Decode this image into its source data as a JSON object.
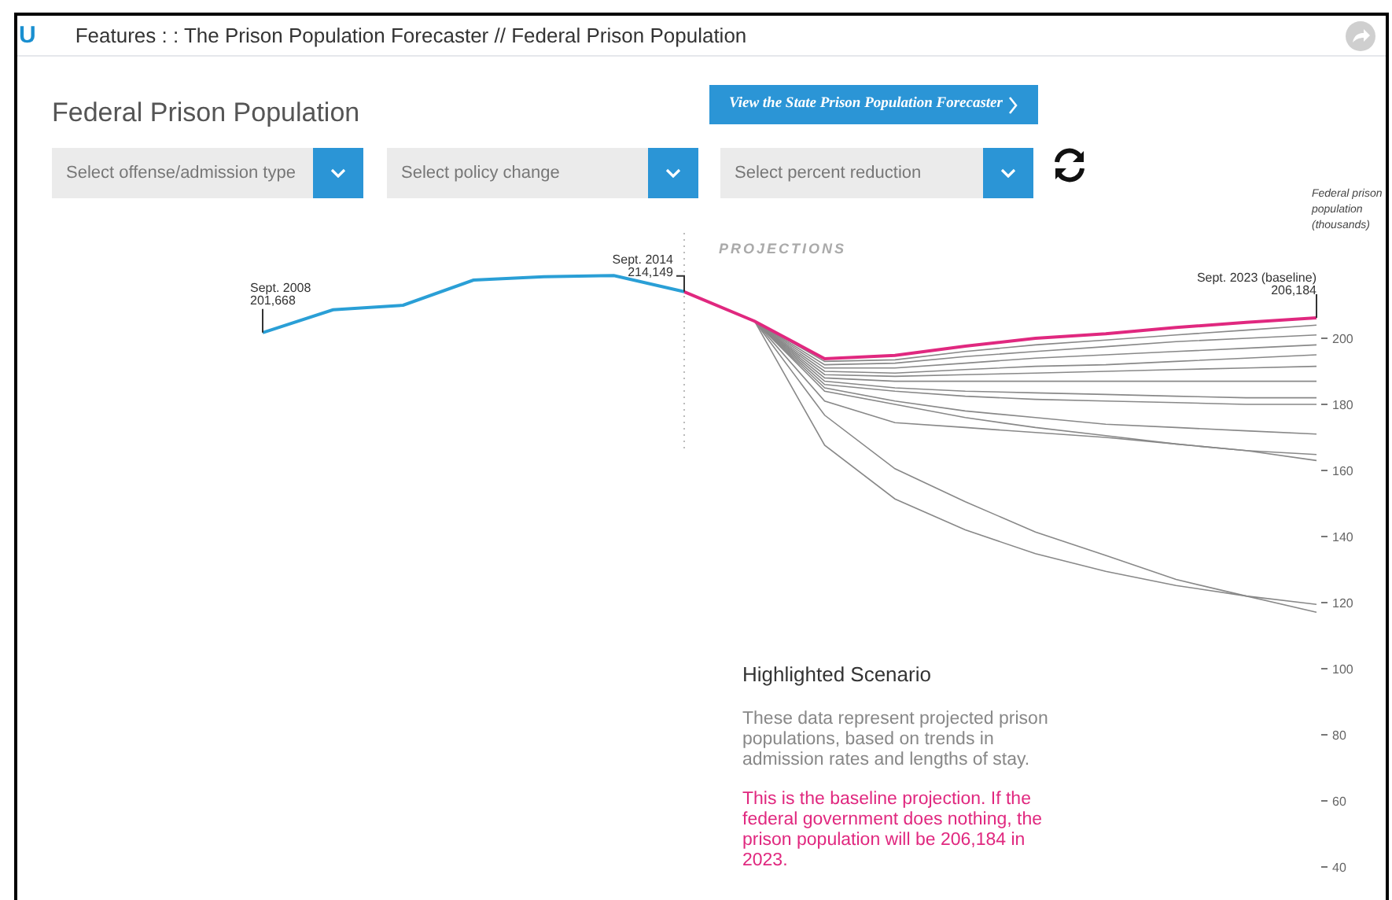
{
  "header": {
    "logo": "U",
    "title": "Features : : The Prison Population Forecaster // Federal Prison Population"
  },
  "page_title": "Federal Prison Population",
  "state_link": {
    "label": "View the State Prison Population Forecaster"
  },
  "dropdowns": [
    {
      "placeholder": "Select offense/admission type"
    },
    {
      "placeholder": "Select policy change"
    },
    {
      "placeholder": "Select percent reduction"
    }
  ],
  "projections_label": "PROJECTIONS",
  "axis_title": "Federal prison population (thousands)",
  "axis_labels": [
    "200",
    "180",
    "160",
    "140",
    "120",
    "100",
    "80",
    "60",
    "40"
  ],
  "callouts": [
    {
      "kind": "start",
      "label": "Sept. 2008",
      "value": "201,668"
    },
    {
      "kind": "latest",
      "label": "Sept. 2014",
      "value": "214,149"
    },
    {
      "kind": "end",
      "label": "Sept. 2023 (baseline)",
      "value": "206,184"
    }
  ],
  "scenario": {
    "heading": "Highlighted Scenario",
    "description": "These data represent projected prison populations, based on trends in admission rates and lengths of stay.",
    "highlight": "This is the baseline projection. If the federal government does nothing, the prison population will be 206,184 in 2023."
  }
}
